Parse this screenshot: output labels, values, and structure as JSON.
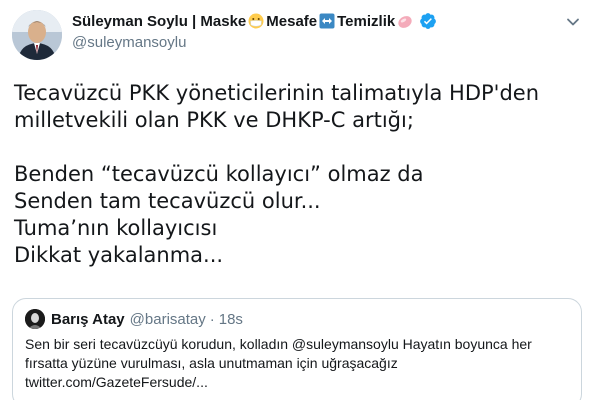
{
  "author": {
    "display_name_part1": "Süleyman Soylu | Maske",
    "display_name_part2": "Mesafe",
    "display_name_part3": "Temizlik",
    "handle": "@suleymansoylu",
    "verified": true
  },
  "tweet": {
    "lines": [
      "Tecavüzcü PKK yöneticilerinin talimatıyla HDP'den",
      "milletvekili olan PKK ve DHKP-C artığı;",
      "",
      "Benden “tecavüzcü kollayıcı” olmaz da",
      "Senden tam tecavüzcü olur...",
      "Tuma’nın kollayıcısı",
      "Dikkat yakalanma..."
    ]
  },
  "quoted_tweet": {
    "name": "Barış Atay",
    "handle": "@barisatay",
    "separator": "·",
    "time": "18s",
    "lines": [
      "Sen bir seri tecavüzcüyü korudun, kolladın @suleymansoylu Hayatın boyunca her",
      "fırsatta yüzüne vurulması, asla unutmaman için uğraşacağız",
      "twitter.com/GazeteFersude/..."
    ]
  },
  "colors": {
    "text": "#14171a",
    "secondary": "#657786",
    "border": "#ccd6dd",
    "verified": "#1da1f2"
  },
  "icons": [
    "mask-face-emoji-icon",
    "left-right-arrow-emoji-icon",
    "soap-emoji-icon",
    "verified-badge-icon",
    "chevron-down-icon"
  ]
}
